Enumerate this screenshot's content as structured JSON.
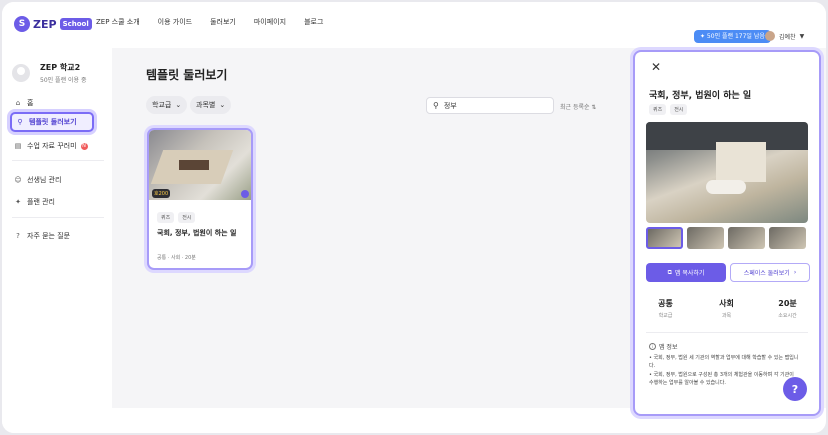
{
  "brand": {
    "name": "ZEP",
    "badge": "School",
    "mark": "S"
  },
  "nav": [
    "ZEP 스쿨 소개",
    "이용 가이드",
    "둘러보기",
    "마이페이지",
    "블로그"
  ],
  "promo": "✦ 50인 플랜 177일 남음",
  "user": {
    "name": "김예찬"
  },
  "profile": {
    "school": "ZEP 학교2",
    "plan": "50인 플랜 이용 중"
  },
  "sidebar": {
    "home": "홈",
    "templates": "템플릿 둘러보기",
    "materials": "수업 자료 꾸러미",
    "materials_badge": "N",
    "teachers": "선생님 관리",
    "plan": "플랜 관리",
    "faq": "자주 묻는 질문"
  },
  "main": {
    "title": "템플릿 둘러보기",
    "filters": [
      "학교급",
      "과목별"
    ],
    "search_value": "정부",
    "sort": "최근 등록순 ⇅"
  },
  "card": {
    "coin": "호200",
    "tags": [
      "퀴즈",
      "전시"
    ],
    "title": "국회, 정부, 법원이 하는 일",
    "meta": "공통 · 사회 · 20분"
  },
  "panel": {
    "title": "국회, 정부, 법원이 하는 일",
    "tags": [
      "퀴즈",
      "전시"
    ],
    "copy_btn": "맵 복사하기",
    "browse_btn": "스페이스 둘러보기",
    "stats": [
      {
        "value": "공통",
        "label": "학교급"
      },
      {
        "value": "사회",
        "label": "과목"
      },
      {
        "value": "20분",
        "label": "소요시간"
      }
    ],
    "info_title": "맵 정보",
    "info": [
      "• 국회, 정부, 법원 세 기관의 역할과 업무에 대해 학습할 수 있는 맵입니다.",
      "• 국회, 정부, 법원으로 구성된 총 3개의 체험관을 이동하며 각 기관이 수행하는 업무를 알아볼 수 있습니다."
    ]
  },
  "colors": {
    "accent": "#6c5ce7",
    "promo": "#4c8cf5"
  }
}
